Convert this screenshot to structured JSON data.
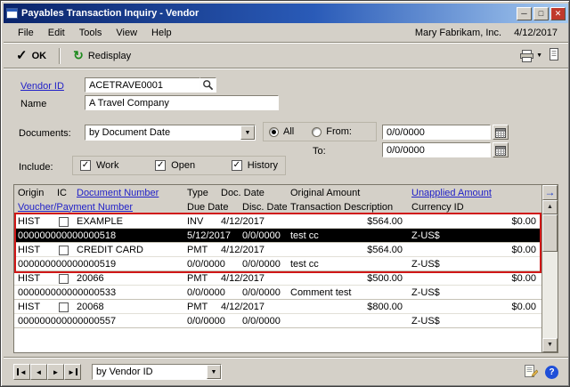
{
  "window": {
    "title": "Payables Transaction Inquiry - Vendor",
    "company": "Mary Fabrikam, Inc.",
    "date": "4/12/2017"
  },
  "menu": {
    "items": [
      "File",
      "Edit",
      "Tools",
      "View",
      "Help"
    ]
  },
  "toolbar": {
    "ok_label": "OK",
    "redisplay_label": "Redisplay"
  },
  "form": {
    "vendor_id_label": "Vendor ID",
    "vendor_id_value": "ACETRAVE0001",
    "name_label": "Name",
    "name_value": "A Travel Company",
    "documents_label": "Documents:",
    "documents_value": "by Document Date",
    "all_label": "All",
    "from_label": "From:",
    "from_value": "0/0/0000",
    "to_label": "To:",
    "to_value": "0/0/0000",
    "include_label": "Include:",
    "work_label": "Work",
    "open_label": "Open",
    "history_label": "History"
  },
  "grid": {
    "headers_line1": {
      "origin": "Origin",
      "ic": "IC",
      "document_number": "Document Number",
      "type": "Type",
      "doc_date": "Doc. Date",
      "original_amount": "Original Amount",
      "unapplied_amount": "Unapplied Amount"
    },
    "headers_line2": {
      "voucher_payment_number": "Voucher/Payment Number",
      "due_date": "Due Date",
      "disc_date": "Disc. Date",
      "transaction_description": "Transaction Description",
      "currency_id": "Currency ID"
    },
    "records": [
      {
        "origin": "HIST",
        "document_number": "EXAMPLE",
        "type": "INV",
        "doc_date": "4/12/2017",
        "original_amount": "$564.00",
        "unapplied_amount": "$0.00",
        "voucher_number": "000000000000000518",
        "due_date": "5/12/2017",
        "disc_date": "0/0/0000",
        "description": "test cc",
        "currency_id": "Z-US$"
      },
      {
        "origin": "HIST",
        "document_number": "CREDIT CARD",
        "type": "PMT",
        "doc_date": "4/12/2017",
        "original_amount": "$564.00",
        "unapplied_amount": "$0.00",
        "voucher_number": "000000000000000519",
        "due_date": "0/0/0000",
        "disc_date": "0/0/0000",
        "description": "test cc",
        "currency_id": "Z-US$"
      },
      {
        "origin": "HIST",
        "document_number": "20066",
        "type": "PMT",
        "doc_date": "4/12/2017",
        "original_amount": "$500.00",
        "unapplied_amount": "$0.00",
        "voucher_number": "000000000000000533",
        "due_date": "0/0/0000",
        "disc_date": "0/0/0000",
        "description": "Comment test",
        "currency_id": "Z-US$"
      },
      {
        "origin": "HIST",
        "document_number": "20068",
        "type": "PMT",
        "doc_date": "4/12/2017",
        "original_amount": "$800.00",
        "unapplied_amount": "$0.00",
        "voucher_number": "000000000000000557",
        "due_date": "0/0/0000",
        "disc_date": "0/0/0000",
        "description": "",
        "currency_id": "Z-US$"
      }
    ]
  },
  "footer": {
    "sort_by_value": "by Vendor ID"
  },
  "icons": {
    "check": "✓",
    "redisplay": "↻",
    "dropdown_arrow": "▼",
    "scroll_up_arrow": "▲",
    "scroll_down_arrow": "▼",
    "nav_prev_arrow": "◄",
    "nav_next_arrow": "►",
    "expand_row_arrow": "→",
    "minimize": "─",
    "maximize": "□",
    "close": "✕",
    "help": "?"
  },
  "colors": {
    "title_bar": "#0a246a",
    "link": "#2121c8",
    "selected_row_bg": "#000000",
    "highlight_border": "#d01818"
  }
}
